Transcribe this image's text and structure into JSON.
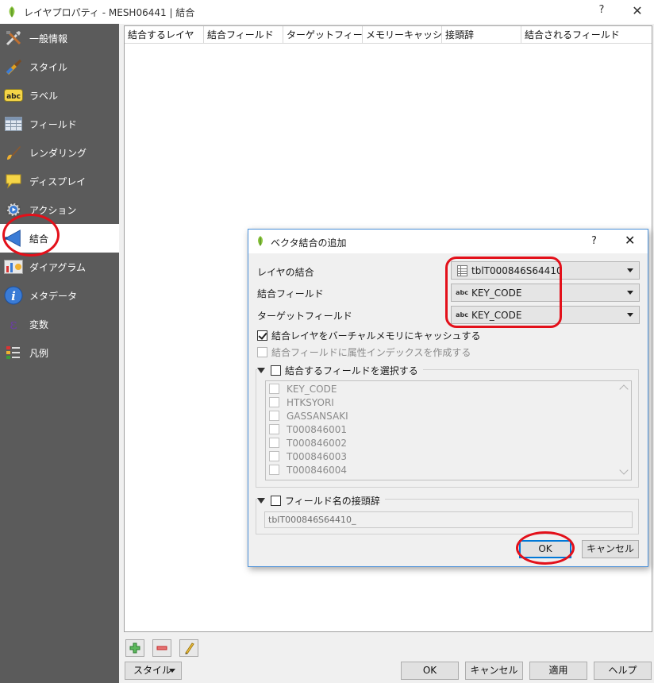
{
  "window": {
    "title": "レイヤプロパティ - MESH06441 | 結合",
    "help_glyph": "?",
    "close_glyph": "✕"
  },
  "sidebar": {
    "items": [
      {
        "label": "一般情報",
        "icon": "tools-icon"
      },
      {
        "label": "スタイル",
        "icon": "paintbrush-icon"
      },
      {
        "label": "ラベル",
        "icon": "abc-label-icon"
      },
      {
        "label": "フィールド",
        "icon": "table-icon"
      },
      {
        "label": "レンダリング",
        "icon": "brush-icon"
      },
      {
        "label": "ディスプレイ",
        "icon": "speech-bubble-icon"
      },
      {
        "label": "アクション",
        "icon": "gear-play-icon"
      },
      {
        "label": "結合",
        "icon": "join-arrow-icon"
      },
      {
        "label": "ダイアグラム",
        "icon": "diagram-icon"
      },
      {
        "label": "メタデータ",
        "icon": "info-icon"
      },
      {
        "label": "変数",
        "icon": "epsilon-icon"
      },
      {
        "label": "凡例",
        "icon": "legend-icon"
      }
    ],
    "active_index": 7
  },
  "joins_table": {
    "columns": [
      "結合するレイヤ",
      "ターゲットフィールド",
      "メモリーキャッシュ",
      "接頭辞",
      "結合されるフィールド"
    ],
    "columns_all": [
      "結合するレイヤ",
      "結合フィールド",
      "ターゲットフィールド",
      "メモリーキャッシュ",
      "接頭辞",
      "結合されるフィールド"
    ]
  },
  "bottom_bar": {
    "style_button": "スタイル",
    "ok": "OK",
    "cancel": "キャンセル",
    "apply": "適用",
    "help": "ヘルプ"
  },
  "dialog": {
    "title": "ベクタ結合の追加",
    "help_glyph": "?",
    "close_glyph": "✕",
    "join_layer_label": "レイヤの結合",
    "join_layer_value": "tblT000846S64410",
    "join_field_label": "結合フィールド",
    "join_field_value": "KEY_CODE",
    "target_field_label": "ターゲットフィールド",
    "target_field_value": "KEY_CODE",
    "field_type_badge": "abc",
    "cache_label": "結合レイヤをバーチャルメモリにキャッシュする",
    "cache_checked": true,
    "index_label": "結合フィールドに属性インデックスを作成する",
    "index_checked": false,
    "select_fields_label": "結合するフィールドを選択する",
    "select_fields_checked": false,
    "fields": [
      "KEY_CODE",
      "HTKSYORI",
      "GASSANSAKI",
      "T000846001",
      "T000846002",
      "T000846003",
      "T000846004"
    ],
    "prefix_group_label": "フィールド名の接頭辞",
    "prefix_checked": false,
    "prefix_value": "tblT000846S64410_",
    "ok": "OK",
    "cancel": "キャンセル"
  },
  "colors": {
    "sidebar_bg": "#5b5b5b",
    "annotation_red": "#e3101a",
    "default_button_border": "#0078d7"
  }
}
